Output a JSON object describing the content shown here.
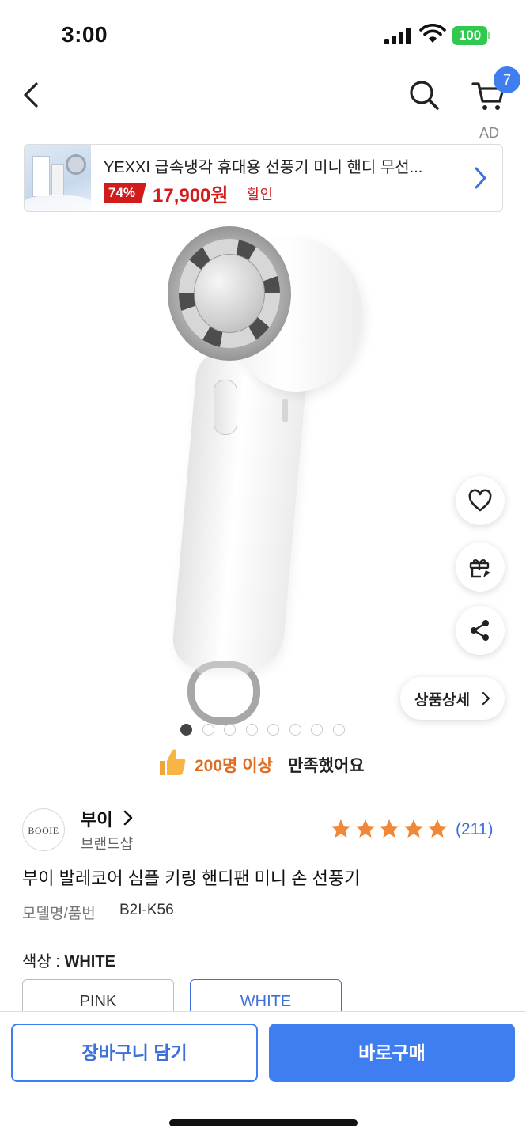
{
  "status_bar": {
    "time": "3:00",
    "battery": "100"
  },
  "nav": {
    "cart_count": "7"
  },
  "ad": {
    "label": "AD",
    "title": "YEXXI 급속냉각 휴대용 선풍기 미니 핸디 무선...",
    "discount": "74%",
    "price": "17,900원",
    "sale_label": "할인"
  },
  "detail_button": {
    "label": "상품상세"
  },
  "gallery": {
    "total": 8,
    "active_index": 0
  },
  "satisfaction": {
    "count": "200명 이상",
    "text": "만족했어요"
  },
  "brand": {
    "logo_text": "BOOIE",
    "name": "부이",
    "type": "브랜드샵"
  },
  "rating": {
    "stars": 5,
    "reviews": "(211)"
  },
  "product": {
    "title": "부이 발레코어 심플 키링 핸디팬 미니 손 선풍기",
    "model_label": "모델명/품번",
    "model_value": "B2I-K56"
  },
  "options": {
    "label_prefix": "색상 : ",
    "selected": "WHITE",
    "items": [
      "PINK",
      "WHITE"
    ]
  },
  "actions": {
    "cart": "장바구니 담기",
    "buy": "바로구매"
  },
  "colors": {
    "accent": "#3f7ef0",
    "price_red": "#d21c1c",
    "highlight_orange": "#e06d1f",
    "star": "#f0883a"
  }
}
